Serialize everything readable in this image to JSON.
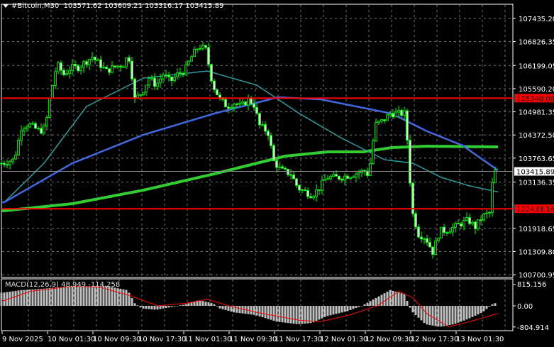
{
  "header": {
    "symbol": "#Bitcoin,M30",
    "open": "103571.62",
    "high": "103609.21",
    "low": "103316.17",
    "close": "103415.89"
  },
  "price_axis": [
    "107435.20",
    "106826.35",
    "106199.05",
    "105590.20",
    "104981.35",
    "104372.50",
    "103763.65",
    "103136.35",
    "101918.65",
    "101309.80",
    "100700.95"
  ],
  "levels": {
    "resistance": "105340.08",
    "support": "102433.16",
    "current": "103415.89"
  },
  "macd": {
    "label": "MACD(12,26,9) 48.949 -114.258",
    "axis": [
      "815.156",
      "0.00",
      "-804.914"
    ]
  },
  "time_axis": [
    "9 Nov 2025",
    "10 Nov 01:30",
    "10 Nov 09:30",
    "10 Nov 17:30",
    "11 Nov 01:30",
    "11 Nov 09:30",
    "11 Nov 17:30",
    "12 Nov 01:30",
    "12 Nov 09:30",
    "12 Nov 17:30",
    "13 Nov 01:30"
  ],
  "colors": {
    "candle": "#00ff00",
    "ma_fast": "#2a9d9d",
    "ma_mid": "#4169e1",
    "ma_slow": "#32cd32",
    "level": "#ff0000",
    "signal": "#ff0000",
    "hist": "#c0c0c0"
  },
  "chart_data": {
    "type": "candlestick",
    "price_keypoints": [
      [
        1,
        103630
      ],
      [
        5,
        103724
      ],
      [
        7.5,
        104563
      ],
      [
        10,
        104656
      ],
      [
        14,
        104470
      ],
      [
        16,
        104563
      ],
      [
        17.5,
        105309
      ],
      [
        19,
        105868
      ],
      [
        20,
        106241
      ],
      [
        22.5,
        105962
      ],
      [
        25,
        106148
      ],
      [
        27.5,
        106148
      ],
      [
        32.5,
        106428
      ],
      [
        37.5,
        106055
      ],
      [
        40,
        106148
      ],
      [
        44,
        106241
      ],
      [
        45,
        106521
      ],
      [
        46,
        106241
      ],
      [
        47.5,
        105309
      ],
      [
        50,
        105496
      ],
      [
        52.5,
        105868
      ],
      [
        55,
        105682
      ],
      [
        57.5,
        105962
      ],
      [
        60,
        105775
      ],
      [
        62.5,
        105962
      ],
      [
        65,
        106055
      ],
      [
        67.5,
        106428
      ],
      [
        70,
        106708
      ],
      [
        72.5,
        106614
      ],
      [
        75,
        105682
      ],
      [
        77.5,
        105309
      ],
      [
        80,
        105122
      ],
      [
        82.5,
        105216
      ],
      [
        85,
        105122
      ],
      [
        87.5,
        105309
      ],
      [
        90,
        105122
      ],
      [
        91,
        104656
      ],
      [
        94,
        104470
      ],
      [
        95,
        104376
      ],
      [
        96,
        103724
      ],
      [
        99,
        103444
      ],
      [
        102.5,
        103351
      ],
      [
        105,
        102978
      ],
      [
        107.5,
        102884
      ],
      [
        110,
        102791
      ],
      [
        112.5,
        102978
      ],
      [
        115,
        103257
      ],
      [
        120,
        103257
      ],
      [
        125,
        103351
      ],
      [
        129,
        103444
      ],
      [
        130,
        103257
      ],
      [
        131,
        104003
      ],
      [
        132.5,
        104656
      ],
      [
        135,
        104749
      ],
      [
        137.5,
        104936
      ],
      [
        140,
        104936
      ],
      [
        142.5,
        104936
      ],
      [
        144,
        103910
      ],
      [
        145,
        102418
      ],
      [
        147.5,
        101765
      ],
      [
        150,
        101672
      ],
      [
        152.5,
        101299
      ],
      [
        155,
        101859
      ],
      [
        157.5,
        101859
      ],
      [
        160,
        101952
      ],
      [
        162.5,
        102045
      ],
      [
        165,
        102138
      ],
      [
        167.5,
        101952
      ],
      [
        170,
        102232
      ],
      [
        172.5,
        102325
      ],
      [
        173.5,
        103071
      ],
      [
        174.5,
        103416
      ]
    ],
    "ma_fast": [
      [
        1,
        102605
      ],
      [
        15,
        103630
      ],
      [
        30,
        105122
      ],
      [
        50,
        105868
      ],
      [
        72.5,
        106055
      ],
      [
        90,
        105682
      ],
      [
        105,
        104936
      ],
      [
        120,
        104283
      ],
      [
        135,
        103724
      ],
      [
        145,
        103630
      ],
      [
        155,
        103257
      ],
      [
        165,
        103034
      ],
      [
        174.5,
        102884
      ]
    ],
    "ma_mid": [
      [
        1,
        102605
      ],
      [
        25,
        103630
      ],
      [
        50,
        104376
      ],
      [
        75,
        104936
      ],
      [
        97.5,
        105365
      ],
      [
        112.5,
        105309
      ],
      [
        137.5,
        104936
      ],
      [
        150,
        104470
      ],
      [
        162.5,
        104097
      ],
      [
        175,
        103444
      ]
    ],
    "ma_slow": [
      [
        1,
        102381
      ],
      [
        25,
        102567
      ],
      [
        50,
        102922
      ],
      [
        75,
        103351
      ],
      [
        100,
        103817
      ],
      [
        115,
        103929
      ],
      [
        127.5,
        103929
      ],
      [
        137.5,
        104041
      ],
      [
        150,
        104078
      ],
      [
        175,
        104059
      ]
    ],
    "macd_hist": [
      [
        1,
        500
      ],
      [
        7.5,
        600
      ],
      [
        15,
        650
      ],
      [
        25,
        750
      ],
      [
        37.5,
        750
      ],
      [
        45,
        600
      ],
      [
        47.5,
        100
      ],
      [
        50,
        -100
      ],
      [
        55,
        -150
      ],
      [
        60,
        -50
      ],
      [
        65,
        50
      ],
      [
        70,
        220
      ],
      [
        75,
        100
      ],
      [
        77.5,
        -100
      ],
      [
        82.5,
        -250
      ],
      [
        90,
        -350
      ],
      [
        97.5,
        -600
      ],
      [
        105,
        -700
      ],
      [
        110,
        -650
      ],
      [
        115,
        -400
      ],
      [
        122.5,
        -200
      ],
      [
        127.5,
        0
      ],
      [
        132.5,
        300
      ],
      [
        137.5,
        600
      ],
      [
        142.5,
        450
      ],
      [
        145,
        -200
      ],
      [
        150,
        -700
      ],
      [
        155,
        -800
      ],
      [
        160,
        -700
      ],
      [
        165,
        -500
      ],
      [
        170,
        -250
      ],
      [
        174,
        100
      ]
    ],
    "macd_signal": [
      [
        1,
        200
      ],
      [
        10,
        550
      ],
      [
        25,
        750
      ],
      [
        35,
        700
      ],
      [
        45,
        400
      ],
      [
        55,
        0
      ],
      [
        65,
        100
      ],
      [
        72.5,
        250
      ],
      [
        80,
        0
      ],
      [
        90,
        -250
      ],
      [
        105,
        -550
      ],
      [
        112.5,
        -600
      ],
      [
        122.5,
        -350
      ],
      [
        132.5,
        0
      ],
      [
        140,
        550
      ],
      [
        145,
        300
      ],
      [
        150,
        -300
      ],
      [
        157.5,
        -800
      ],
      [
        165,
        -600
      ],
      [
        174.5,
        -300
      ]
    ],
    "price_range": [
      100700.95,
      107435.2
    ],
    "macd_range": [
      -804.914,
      815.156
    ]
  }
}
